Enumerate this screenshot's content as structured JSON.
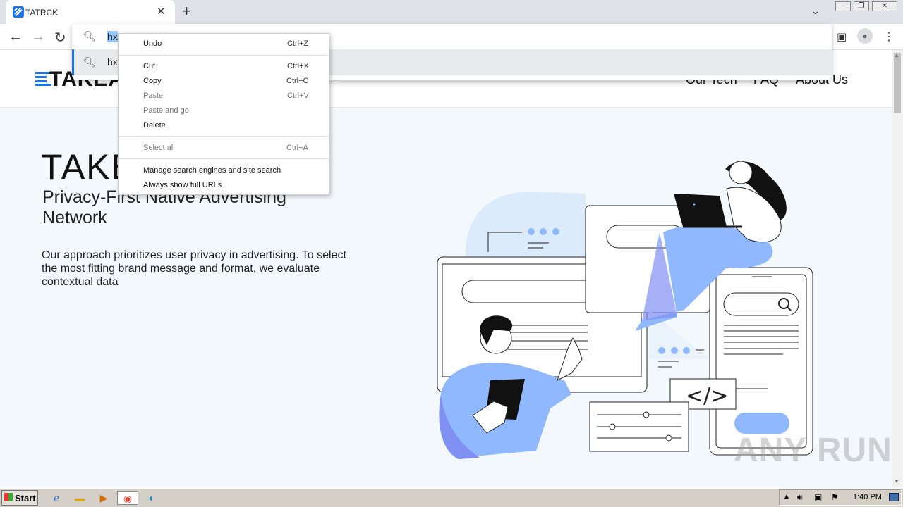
{
  "browser": {
    "tab_title": "TATRCK",
    "tab_close": "✕",
    "new_tab": "+",
    "tab_search": "⌄",
    "window_buttons": [
      "‒",
      "❐",
      "✕"
    ],
    "nav": {
      "back": "←",
      "forward": "→",
      "reload": "↻"
    },
    "omnibox_text": "hx",
    "suggestion_text": "hx",
    "side_panel_icon": "▣",
    "profile_icon": "●",
    "menu_icon": "⋮"
  },
  "site": {
    "logo_text": "TAKEA",
    "nav": [
      "Our Tech",
      "FAQ",
      "About Us"
    ],
    "hero_title": "TAKE",
    "hero_subtitle": "Privacy-First Native Advertising Network",
    "hero_body": "Our approach prioritizes user privacy in advertising. To select the most fitting brand message and format, we evaluate contextual data"
  },
  "context_menu": {
    "items": [
      {
        "label": "Undo",
        "shortcut": "Ctrl+Z",
        "disabled": false
      },
      {
        "label": "Cut",
        "shortcut": "Ctrl+X",
        "disabled": false
      },
      {
        "label": "Copy",
        "shortcut": "Ctrl+C",
        "disabled": false
      },
      {
        "label": "Paste",
        "shortcut": "Ctrl+V",
        "disabled": true
      },
      {
        "label": "Paste and go",
        "shortcut": "",
        "disabled": true
      },
      {
        "label": "Delete",
        "shortcut": "",
        "disabled": false
      },
      {
        "label": "Select all",
        "shortcut": "Ctrl+A",
        "disabled": true
      },
      {
        "label": "Manage search engines and site search",
        "shortcut": "",
        "disabled": false
      },
      {
        "label": "Always show full URLs",
        "shortcut": "",
        "disabled": false
      }
    ]
  },
  "watermark": "ANY RUN",
  "taskbar": {
    "start_label": "Start",
    "clock": "1:40 PM"
  },
  "colors": {
    "accent": "#1a73e8",
    "hero_bg": "#f3f8fc",
    "illus_blue": "#8fb8ff",
    "illus_purple": "#8a8ff5"
  }
}
